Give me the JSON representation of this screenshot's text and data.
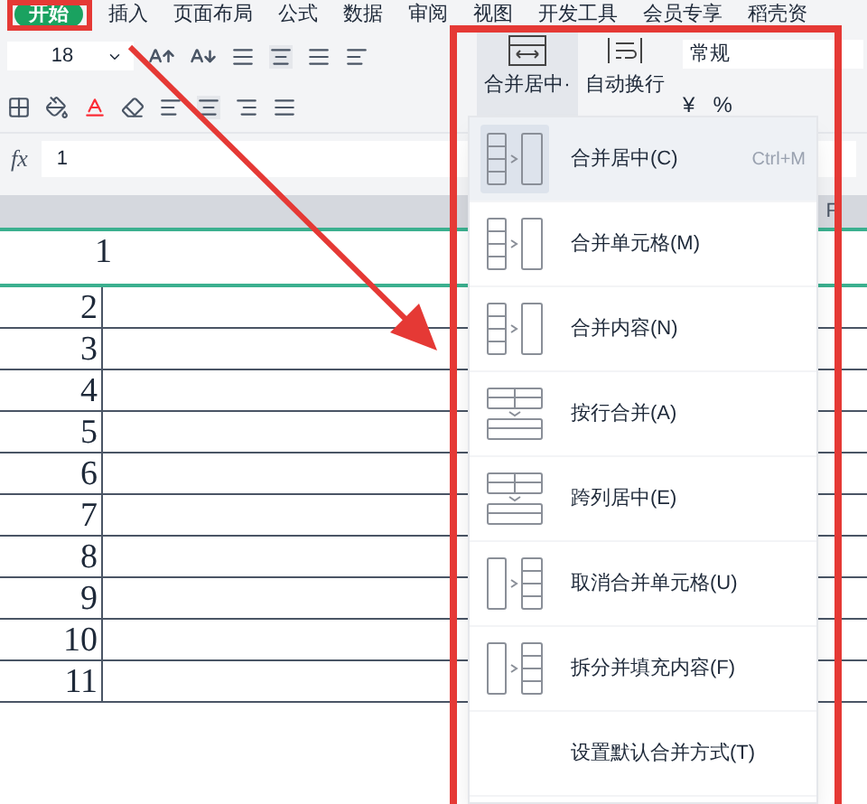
{
  "menu_tabs": [
    {
      "label": "开始",
      "selected": true
    },
    {
      "label": "插入",
      "selected": false
    },
    {
      "label": "页面布局",
      "selected": false
    },
    {
      "label": "公式",
      "selected": false
    },
    {
      "label": "数据",
      "selected": false
    },
    {
      "label": "审阅",
      "selected": false
    },
    {
      "label": "视图",
      "selected": false
    },
    {
      "label": "开发工具",
      "selected": false
    },
    {
      "label": "会员专享",
      "selected": false
    },
    {
      "label": "稻壳资",
      "selected": false
    }
  ],
  "ribbon": {
    "font_size": "18",
    "merge_button": "合并居中·",
    "wrap_button": "自动换行",
    "number_format": "常规",
    "percent": "%",
    "currency": "¥"
  },
  "formula_bar": {
    "fx": "fx",
    "value": "1"
  },
  "sheet": {
    "right_column": "F",
    "rows": [
      "1",
      "2",
      "3",
      "4",
      "5",
      "6",
      "7",
      "8",
      "9",
      "10",
      "11"
    ]
  },
  "merge_menu": [
    {
      "kind": "merge_center",
      "label": "合并居中(C)",
      "shortcut": "Ctrl+M",
      "selected": true
    },
    {
      "kind": "merge_cells",
      "label": "合并单元格(M)",
      "selected": false
    },
    {
      "kind": "merge_content",
      "label": "合并内容(N)",
      "selected": false
    },
    {
      "kind": "merge_rows",
      "label": "按行合并(A)",
      "selected": false
    },
    {
      "kind": "center_across",
      "label": "跨列居中(E)",
      "selected": false
    },
    {
      "kind": "unmerge",
      "label": "取消合并单元格(U)",
      "selected": false
    },
    {
      "kind": "split_fill",
      "label": "拆分并填充内容(F)",
      "selected": false
    },
    {
      "kind": "default",
      "label": "设置默认合并方式(T)",
      "selected": false
    }
  ]
}
